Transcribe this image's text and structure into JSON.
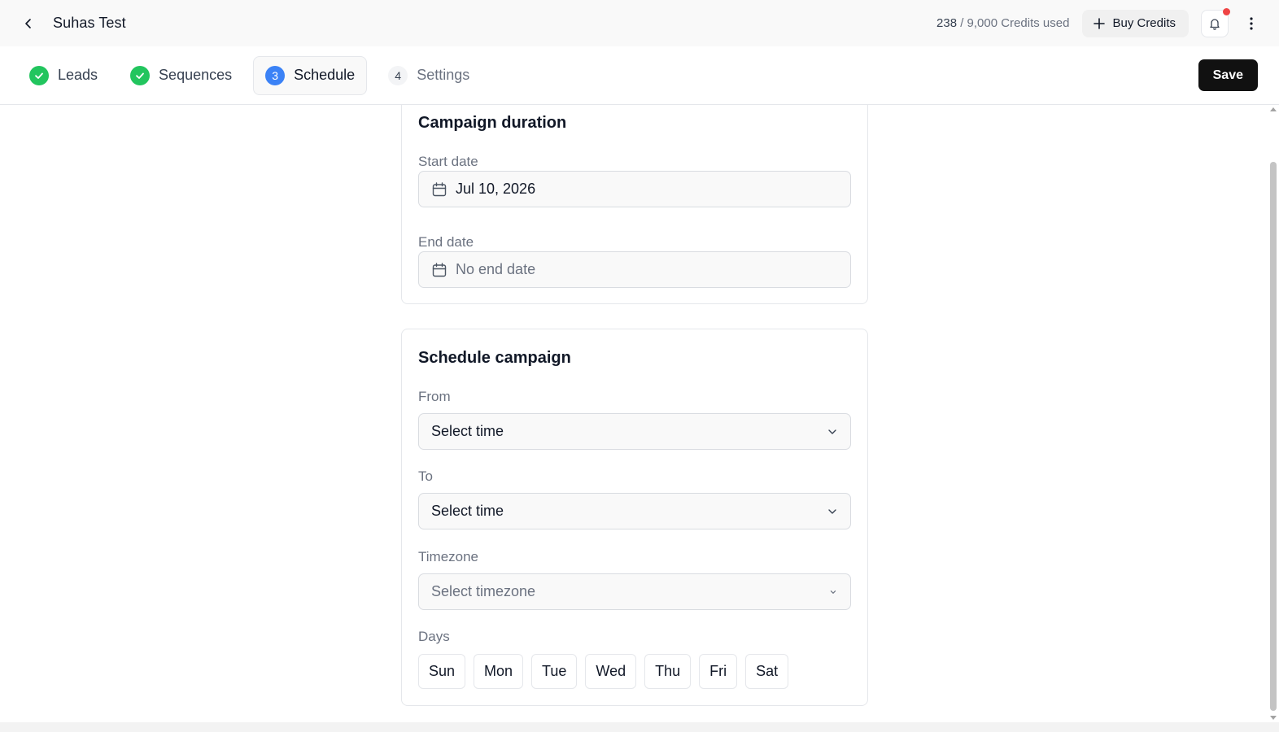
{
  "header": {
    "title": "Suhas Test",
    "credits_used": "238",
    "credits_total_text": " / 9,000 Credits used",
    "buy_credits_label": "Buy Credits"
  },
  "steps": [
    {
      "number": "",
      "label": "Leads",
      "state": "done"
    },
    {
      "number": "",
      "label": "Sequences",
      "state": "done"
    },
    {
      "number": "3",
      "label": "Schedule",
      "state": "current"
    },
    {
      "number": "4",
      "label": "Settings",
      "state": "pending"
    }
  ],
  "save_label": "Save",
  "campaign_duration": {
    "title": "Campaign duration",
    "start_label": "Start date",
    "start_value": "Jul 10, 2026",
    "end_label": "End date",
    "end_value": "No end date"
  },
  "schedule": {
    "title": "Schedule campaign",
    "from_label": "From",
    "from_value": "Select time",
    "to_label": "To",
    "to_value": "Select time",
    "timezone_label": "Timezone",
    "timezone_value": "Select timezone",
    "days_label": "Days",
    "days": [
      "Sun",
      "Mon",
      "Tue",
      "Wed",
      "Thu",
      "Fri",
      "Sat"
    ]
  },
  "colors": {
    "done": "#22c55e",
    "current": "#3b82f6",
    "save_bg": "#111111",
    "notification_dot": "#ef4444"
  }
}
